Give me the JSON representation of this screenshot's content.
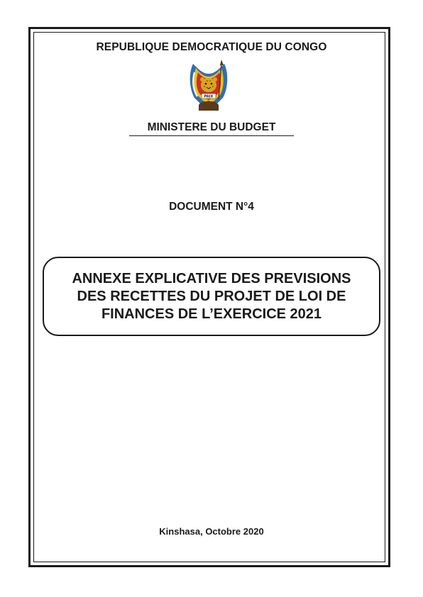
{
  "document": {
    "republic": "REPUBLIQUE DEMOCRATIQUE DU CONGO",
    "ministry": "MINISTERE DU BUDGET",
    "document_number": "DOCUMENT N°4",
    "title_lines": [
      "ANNEXE EXPLICATIVE DES PREVISIONS",
      "DES RECETTES DU PROJET DE LOI DE",
      "FINANCES DE L’EXERCICE 2021"
    ],
    "place_date": "Kinshasa, Octobre 2020"
  },
  "emblem": {
    "icon": "coat-of-arms-icon",
    "motto": "PAIX",
    "colors": {
      "blue": "#2f6fb3",
      "yellow": "#e8c21a",
      "red": "#c8302a",
      "leopard": "#d9a520",
      "dark": "#5a3a1a"
    }
  }
}
